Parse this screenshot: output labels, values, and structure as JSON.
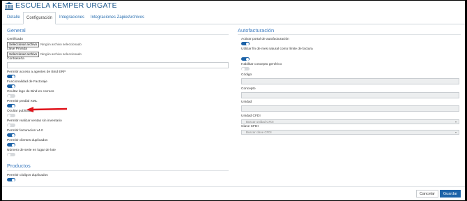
{
  "header": {
    "title": "ESCUELA KEMPER URGATE",
    "icon": "bank-icon"
  },
  "tabs": [
    {
      "label": "Detalle",
      "active": false
    },
    {
      "label": "Configuración",
      "active": true
    },
    {
      "label": "Integraciones",
      "active": false
    },
    {
      "label": "Integraciones Zapier",
      "active": false
    },
    {
      "label": "Archivos",
      "active": false
    }
  ],
  "general": {
    "title": "General",
    "certificado_label": "Certificado",
    "certificado_button": "Seleccionar archivo",
    "certificado_status": "Ningún archivo seleccionado",
    "llave_label": "Llave Privada",
    "llave_button": "Seleccionar archivo",
    "llave_status": "Ningún archivo seleccionado",
    "password_label": "Contraseña",
    "password_value": "",
    "toggles": [
      {
        "label": "Permitir acceso a agentes de Bind ERP",
        "on": true
      },
      {
        "label": "Funcionalidad de Factoraje",
        "on": true
      },
      {
        "label": "Ocultar logo de Bind en correos",
        "on": false
      },
      {
        "label": "Permitir predial XML",
        "on": true
      },
      {
        "label": "Ocultar publicidad",
        "on": false
      },
      {
        "label": "Permitir realizar ventas sin inventario",
        "on": false
      },
      {
        "label": "Permitir facturacion v4.0",
        "on": true
      },
      {
        "label": "Permitir clientes duplicados",
        "on": true
      },
      {
        "label": "Número de serie en lugar de lote",
        "on": false
      }
    ]
  },
  "productos": {
    "title": "Productos",
    "toggles": [
      {
        "label": "Permitir códigos duplicados",
        "on": true
      }
    ]
  },
  "autofacturacion": {
    "title": "Autofacturación",
    "toggles": [
      {
        "label": "Activar portal de autofacturación",
        "on": true
      },
      {
        "label": "Utilizar fin de mes natural como límite de factura",
        "on": true
      },
      {
        "label": "Habilitar concepto genérico",
        "on": false
      }
    ],
    "codigo_label": "Código",
    "concepto_label": "Concepto",
    "unidad_label": "Unidad",
    "unidad_cfdi_label": "Unidad CFDI",
    "unidad_cfdi_placeholder": "Buscar unidad CFDI",
    "clave_cfdi_label": "Clave CFDI",
    "clave_cfdi_placeholder": "Buscar clave CFDI"
  },
  "footer": {
    "cancel_label": "Cancelar",
    "save_label": "Guardar"
  },
  "colors": {
    "accent": "#1d63a8",
    "title": "#3b7abf",
    "annotation": "#e0131b"
  }
}
